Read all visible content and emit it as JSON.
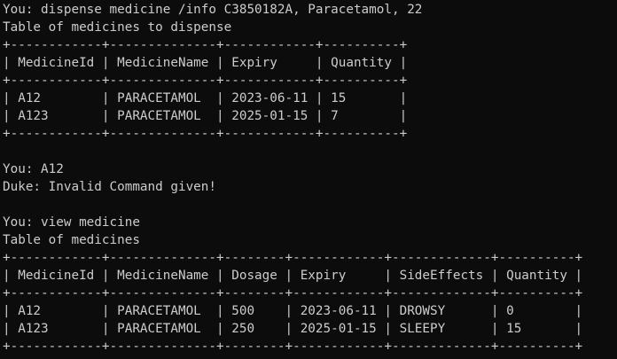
{
  "lines": [
    "You: dispense medicine /info C3850182A, Paracetamol, 22",
    "Table of medicines to dispense",
    "+------------+--------------+------------+----------+",
    "| MedicineId | MedicineName | Expiry     | Quantity |",
    "+------------+--------------+------------+----------+",
    "| A12        | PARACETAMOL  | 2023-06-11 | 15       |",
    "| A123       | PARACETAMOL  | 2025-01-15 | 7        |",
    "+------------+--------------+------------+----------+",
    "",
    "You: A12",
    "Duke: Invalid Command given!",
    "",
    "You: view medicine",
    "Table of medicines",
    "+------------+--------------+--------+------------+-------------+----------+",
    "| MedicineId | MedicineName | Dosage | Expiry     | SideEffects | Quantity |",
    "+------------+--------------+--------+------------+-------------+----------+",
    "| A12        | PARACETAMOL  | 500    | 2023-06-11 | DROWSY      | 0        |",
    "| A123       | PARACETAMOL  | 250    | 2025-01-15 | SLEEPY      | 15       |",
    "+------------+--------------+--------+------------+-------------+----------+"
  ]
}
